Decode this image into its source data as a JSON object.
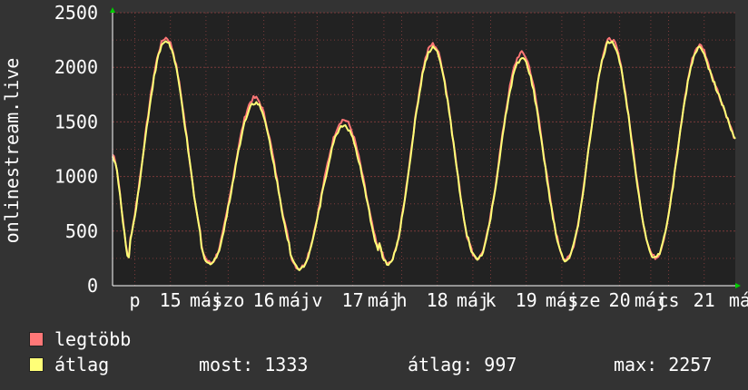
{
  "chart_data": {
    "type": "line",
    "ylabel": "onlinestream.live",
    "ylim": [
      0,
      2500
    ],
    "y_ticks": [
      "2500",
      "2000",
      "1500",
      "1000",
      "500",
      "0"
    ],
    "y_tick_values": [
      2500,
      2000,
      1500,
      1000,
      500,
      0
    ],
    "x_ticks": [
      {
        "label": "p",
        "t": 0.25
      },
      {
        "label": "15",
        "t": 0.65
      },
      {
        "label": "máj",
        "t": 1.05
      },
      {
        "label": "szo",
        "t": 1.3
      },
      {
        "label": "16",
        "t": 1.7
      },
      {
        "label": "máj",
        "t": 2.05
      },
      {
        "label": "v",
        "t": 2.3
      },
      {
        "label": "17",
        "t": 2.7
      },
      {
        "label": "máj",
        "t": 3.05
      },
      {
        "label": "h",
        "t": 3.25
      },
      {
        "label": "18",
        "t": 3.65
      },
      {
        "label": "máj",
        "t": 4.05
      },
      {
        "label": "k",
        "t": 4.25
      },
      {
        "label": "19",
        "t": 4.65
      },
      {
        "label": "máj",
        "t": 5.05
      },
      {
        "label": "sze",
        "t": 5.3
      },
      {
        "label": "20",
        "t": 5.7
      },
      {
        "label": "máj",
        "t": 6.05
      },
      {
        "label": "cs",
        "t": 6.25
      },
      {
        "label": "21",
        "t": 6.65
      },
      {
        "label": "má",
        "t": 7.05
      }
    ],
    "x_range": [
      0,
      7.0
    ],
    "colors": {
      "max": "#ff7777",
      "avg": "#ffff77",
      "grid": "#7a3a3a",
      "background": "#222222",
      "axis": "#ffffff",
      "arrow": "#00cc00"
    },
    "series": [
      {
        "name": "legtöbb",
        "color": "#ff7777",
        "peaks": [
          2270,
          1720,
          1520,
          2210,
          2130,
          2260,
          2200
        ],
        "troughs_start": 1200,
        "troughs": [
          240,
          210,
          160,
          200,
          250,
          240,
          260
        ]
      },
      {
        "name": "átlag",
        "color": "#ffff77",
        "peaks": [
          2240,
          1680,
          1470,
          2180,
          2080,
          2240,
          2180
        ],
        "troughs_start": 1180,
        "troughs": [
          230,
          200,
          155,
          195,
          245,
          235,
          255
        ]
      }
    ],
    "end_value": 1333
  },
  "legend": [
    {
      "label": "legtöbb",
      "color": "#ff7777"
    },
    {
      "label": "átlag",
      "color": "#ffff77"
    }
  ],
  "stats": {
    "most": "most: 1333",
    "atlag": "átlag: 997",
    "max": "max: 2257"
  }
}
